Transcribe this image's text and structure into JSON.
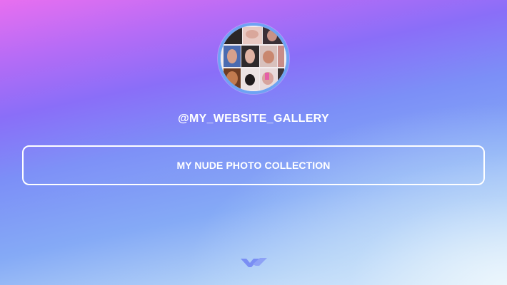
{
  "profile": {
    "avatar_icon": "photo-collage-avatar",
    "username": "@MY_WEBSITE_GALLERY"
  },
  "links": [
    {
      "label": "MY NUDE PHOTO COLLECTION"
    }
  ],
  "footer": {
    "logo_icon": "chevron-logo-icon"
  },
  "colors": {
    "background_top": "#e86ff0",
    "background_mid": "#7c8ff7",
    "background_bottom": "#e4f2fb",
    "avatar_border": "#6ea3f3",
    "text": "#ffffff",
    "logo": "#7a8ef4"
  }
}
